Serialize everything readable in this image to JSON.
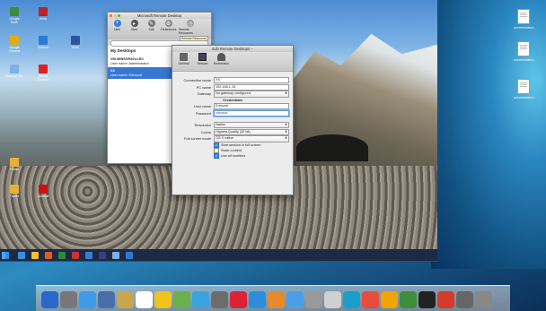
{
  "mac_desktop": {
    "files": [
      "nonrevisited...",
      "nonrevisited...",
      "nonrevisited..."
    ]
  },
  "windows_desktop": {
    "icons": [
      {
        "label": "Google Earth",
        "color": "#3a8b3a"
      },
      {
        "label": "Avira",
        "color": "#b22"
      },
      {
        "label": "Google Chrome",
        "color": "#e1ab16"
      },
      {
        "label": "Outlook",
        "color": "#2b7bd3"
      },
      {
        "label": "Word",
        "color": "#2b5797"
      },
      {
        "label": "Recycle Bin",
        "color": "#7fb2e5"
      },
      {
        "label": "Adobe Reader",
        "color": "#d22"
      },
      {
        "label": "Folder",
        "color": "#e6b03a"
      },
      {
        "label": "Folder",
        "color": "#e6b03a"
      },
      {
        "label": "Acrobat",
        "color": "#c11"
      }
    ]
  },
  "mrd": {
    "title": "Microsoft Remote Desktop",
    "toolbar": [
      "New",
      "Start",
      "Edit",
      "Preferences",
      "Remote Resources"
    ],
    "tooltip": "Remote Resources",
    "list_heading": "My Desktops",
    "entries": [
      {
        "name": "VM-WINSVR2012-R2",
        "user": "User name: Administrator",
        "selected": false
      },
      {
        "name": "XX",
        "user": "User name: Edmund",
        "selected": true
      }
    ]
  },
  "edit": {
    "title": "Edit Remote Desktops –",
    "tabs": [
      "General",
      "Session",
      "Redirection"
    ],
    "fields": {
      "connection_name_label": "Connection name",
      "connection_name": "XX",
      "pc_name_label": "PC name",
      "pc_name": "192.168.1.13",
      "gateway_label": "Gateway",
      "gateway": "No gateway configured",
      "credentials_heading": "Credentials",
      "username_label": "User name",
      "username": "Edmund",
      "password_label": "Password",
      "password": "••••••••••",
      "resolution_label": "Resolution",
      "resolution": "Native",
      "colors_label": "Colors",
      "colors": "Highest Quality (32 bit)",
      "fullscreen_label": "Full screen mode",
      "fullscreen": "OS X native"
    },
    "checks": [
      {
        "label": "Start session in full screen",
        "checked": true
      },
      {
        "label": "Scale content",
        "checked": false
      },
      {
        "label": "Use all monitors",
        "checked": true
      }
    ]
  },
  "taskbar": {
    "apps": [
      "#3b8de0",
      "#f2c12e",
      "#e35b1f",
      "#2c8a3d",
      "#c33",
      "#3a7bd5",
      "#3d3d8f",
      "#7fb2e5",
      "#2b7bd3"
    ]
  },
  "dock": {
    "apps": [
      "#2b66c9",
      "#777",
      "#3d9be9",
      "#4a6fa8",
      "#c9a64c",
      "#fff",
      "#f0c419",
      "#6ab04c",
      "#39a3e0",
      "#6c6c6c",
      "#d23",
      "#2d8dd8",
      "#e8892a",
      "#4aa0e6",
      "#999",
      "#d0d0d0",
      "#19a0c8",
      "#e84c3d",
      "#f0a500",
      "#3d8e3d",
      "#222",
      "#d63a2a",
      "#666",
      "#888"
    ]
  }
}
